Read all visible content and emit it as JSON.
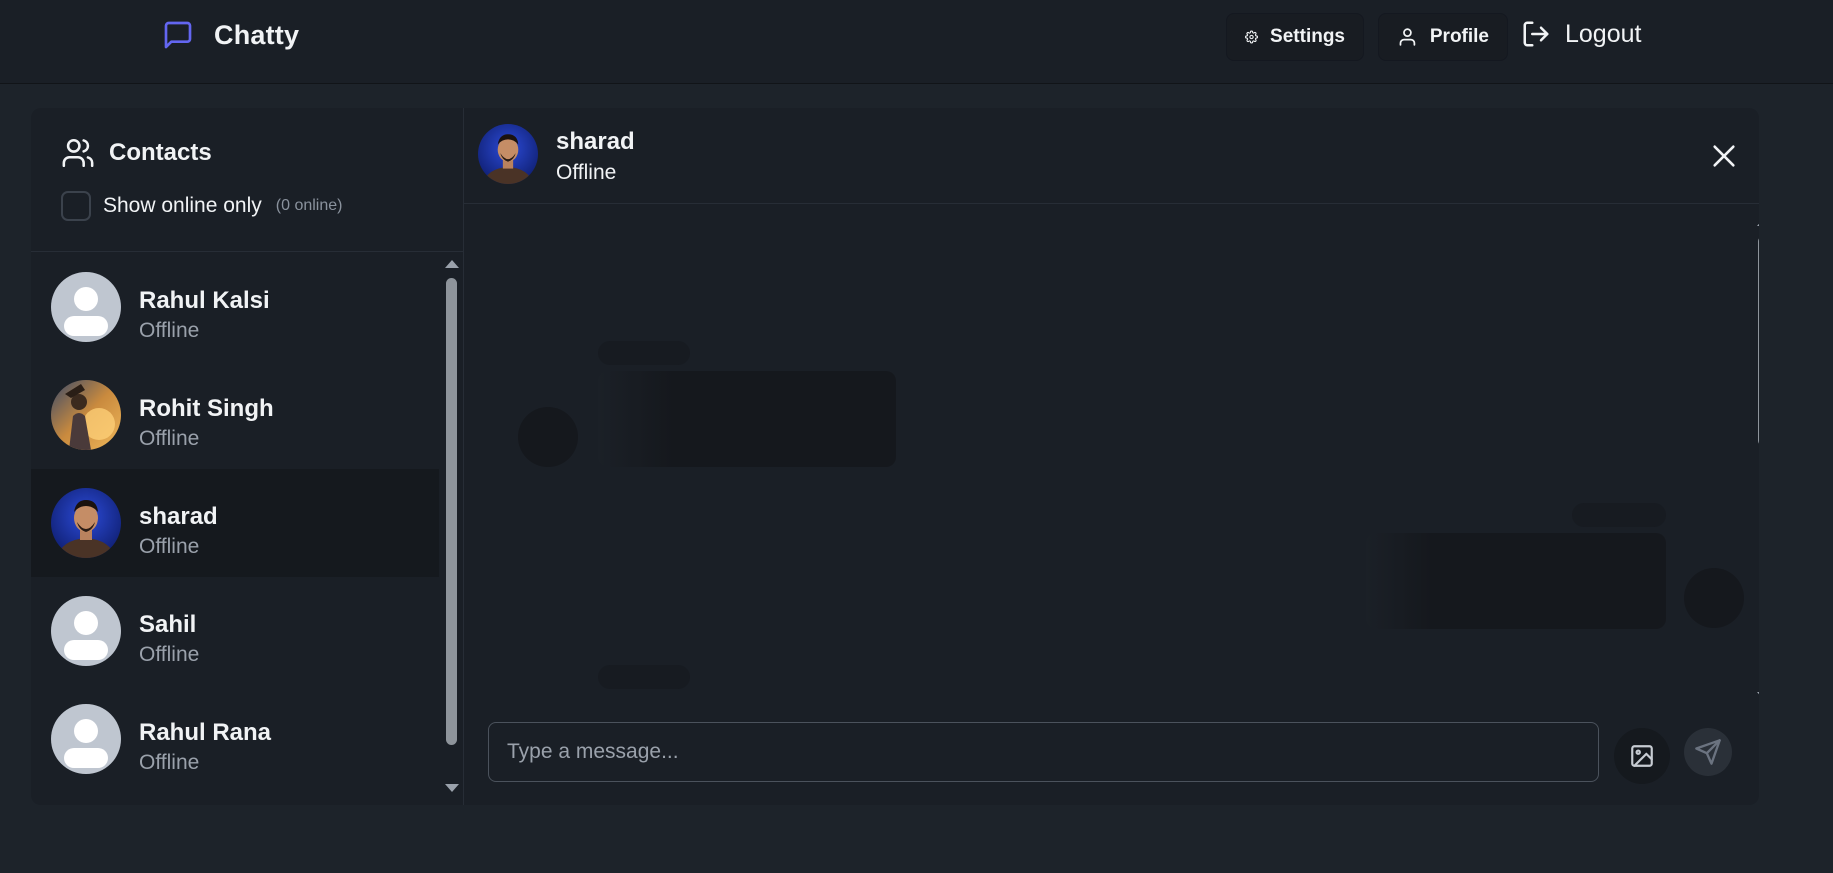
{
  "app": {
    "title": "Chatty",
    "accent_color": "#6366f1"
  },
  "navbar": {
    "settings_label": "Settings",
    "profile_label": "Profile",
    "logout_label": "Logout",
    "icons": [
      "message-square-icon",
      "gear-icon",
      "user-icon",
      "log-out-icon"
    ]
  },
  "sidebar": {
    "title": "Contacts",
    "filter_label": "Show online only",
    "online_count": "(0 online)",
    "contacts": [
      {
        "name": "Rahul Kalsi",
        "status": "Offline",
        "avatar": "default-avatar",
        "selected": false
      },
      {
        "name": "Rohit Singh",
        "status": "Offline",
        "avatar": "photo-avatar",
        "selected": false
      },
      {
        "name": "sharad",
        "status": "Offline",
        "avatar": "photo-avatar",
        "selected": true
      },
      {
        "name": "Sahil",
        "status": "Offline",
        "avatar": "default-avatar",
        "selected": false
      },
      {
        "name": "Rahul Rana",
        "status": "Offline",
        "avatar": "default-avatar",
        "selected": false
      }
    ]
  },
  "chat": {
    "contact_name": "sharad",
    "contact_status": "Offline",
    "loading": true,
    "input_placeholder": "Type a message..."
  }
}
